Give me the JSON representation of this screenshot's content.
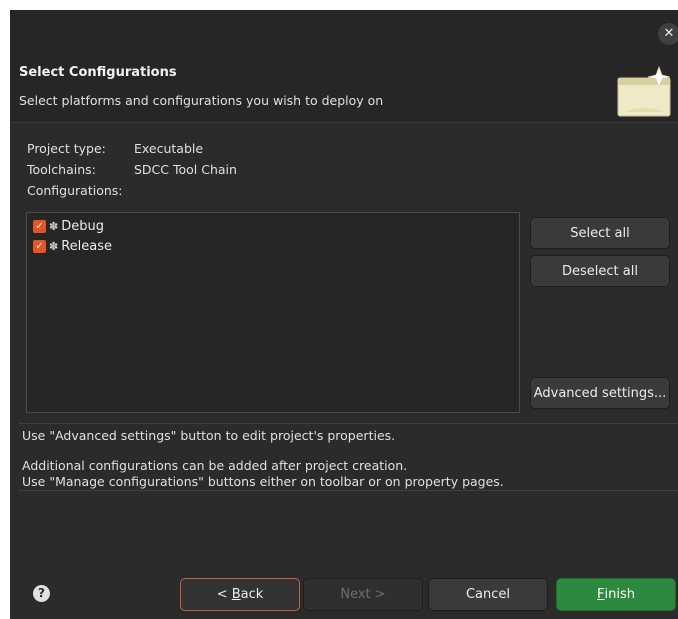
{
  "header": {
    "title": "Select Configurations",
    "subtitle": "Select platforms and configurations you wish to deploy on"
  },
  "info": {
    "project_type_label": "Project type:",
    "project_type_value": "Executable",
    "toolchains_label": "Toolchains:",
    "toolchains_value": "SDCC Tool Chain",
    "configurations_label": "Configurations:"
  },
  "configurations": [
    {
      "label": "Debug",
      "checked": true,
      "icon": "gear-icon"
    },
    {
      "label": "Release",
      "checked": true,
      "icon": "gear-icon"
    }
  ],
  "side_buttons": {
    "select_all": "Select all",
    "deselect_all": "Deselect all",
    "advanced": "Advanced settings..."
  },
  "messages": {
    "line1": "Use \"Advanced settings\" button to edit project's properties.",
    "line2": "Additional configurations can be added after project creation.",
    "line3": "Use \"Manage configurations\" buttons either on toolbar or on property pages."
  },
  "footer": {
    "back_prefix": "< ",
    "back_mnemonic": "B",
    "back_rest": "ack",
    "next": "Next >",
    "cancel": "Cancel",
    "finish_mnemonic": "F",
    "finish_rest": "inish"
  },
  "colors": {
    "accent": "#e95420",
    "finish": "#2b8a3e",
    "background": "#2b2b2b"
  }
}
